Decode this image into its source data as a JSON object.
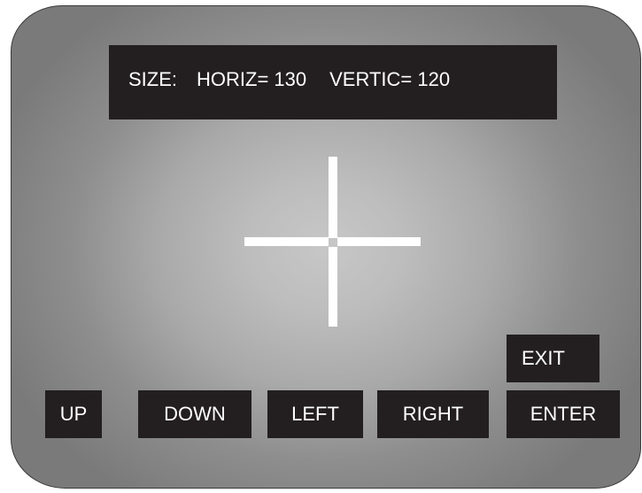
{
  "readout": {
    "size_label": "SIZE:",
    "horiz": "HORIZ= 130",
    "vertic": "VERTIC= 120"
  },
  "buttons": {
    "up": "UP",
    "down": "DOWN",
    "left": "LEFT",
    "right": "RIGHT",
    "enter": "ENTER",
    "exit": "EXIT"
  },
  "colors": {
    "panel_background": "#231f20",
    "text": "#ffffff",
    "crosshair": "#ffffff",
    "screen_center": "#c7c7c7",
    "screen_edge": "#7a7a7a"
  }
}
